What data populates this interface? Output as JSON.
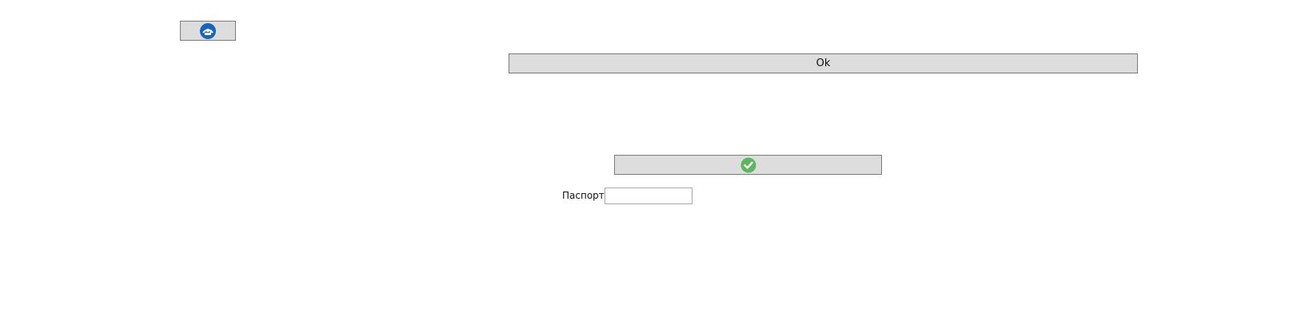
{
  "toolbar": {
    "refresh_icon": "refresh-ship-icon",
    "ok_label": "Ok",
    "confirm_icon": "green-check-icon"
  },
  "form": {
    "passport_label": "Паспорт",
    "passport_value": "",
    "passport_placeholder": ""
  },
  "colors": {
    "button_bg": "#dddddd",
    "button_border": "#7a7a7a",
    "refresh_icon_blue": "#1565c0",
    "check_green": "#5cb85c"
  }
}
